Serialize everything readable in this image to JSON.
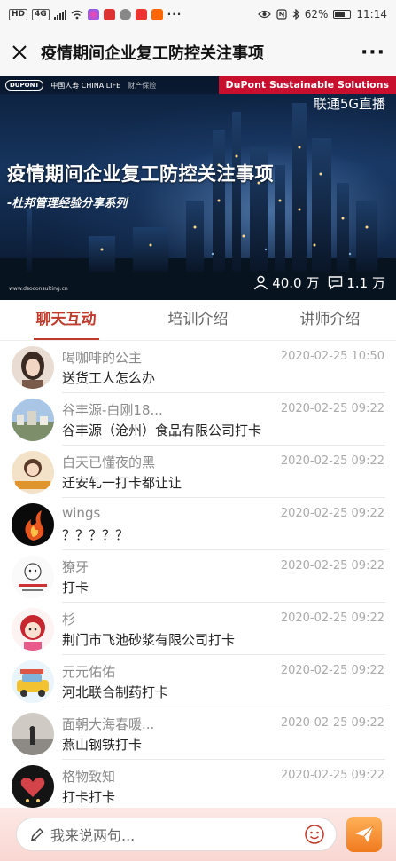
{
  "status_bar": {
    "left_tags": [
      "HD",
      "4G"
    ],
    "battery": "62%",
    "time": "11:14",
    "more_dots": "···"
  },
  "title_bar": {
    "title": "疫情期间企业复工防控关注事项",
    "more": "···"
  },
  "banner": {
    "logo_left": "DUPONT",
    "logo_chinalife": "中国人寿 CHINA LIFE",
    "logo_chinalife_sub": "财产保险",
    "brand_tag": "DuPont Sustainable Solutions",
    "live_label": "联通5G直播",
    "heading": "疫情期间企业复工防控关注事项",
    "subheading": "-杜邦管理经验分享系列",
    "url": "www.dsoconsulting.cn",
    "viewers": "40.0 万",
    "comments": "1.1 万"
  },
  "tabs": [
    {
      "label": "聊天互动",
      "active": true
    },
    {
      "label": "培训介绍",
      "active": false
    },
    {
      "label": "讲师介绍",
      "active": false
    }
  ],
  "chat": [
    {
      "name": "喝咖啡的公主",
      "time": "2020-02-25 10:50",
      "message": "送货工人怎么办",
      "avatar": "portrait-woman"
    },
    {
      "name": "谷丰源-白刚18...",
      "time": "2020-02-25 09:22",
      "message": "谷丰源（沧州）食品有限公司打卡",
      "avatar": "landscape-city"
    },
    {
      "name": "白天已懂夜的黑",
      "time": "2020-02-25 09:22",
      "message": "迁安轧一打卡都让让",
      "avatar": "cartoon-girl"
    },
    {
      "name": "wings",
      "time": "2020-02-25 09:22",
      "message": "？？？？？",
      "avatar": "fire-dark"
    },
    {
      "name": "獠牙",
      "time": "2020-02-25 09:22",
      "message": "打卡",
      "avatar": "doodle-white"
    },
    {
      "name": "杉",
      "time": "2020-02-25 09:22",
      "message": "荆门市飞池砂浆有限公司打卡",
      "avatar": "cartoon-red"
    },
    {
      "name": "元元佑佑",
      "time": "2020-02-25 09:22",
      "message": "河北联合制药打卡",
      "avatar": "yellow-car"
    },
    {
      "name": "面朝大海春暖...",
      "time": "2020-02-25 09:22",
      "message": "燕山钢铁打卡",
      "avatar": "sea-figure"
    },
    {
      "name": "格物致知",
      "time": "2020-02-25 09:22",
      "message": "打卡打卡",
      "avatar": "dark-heart"
    }
  ],
  "input": {
    "placeholder": "我来说两句..."
  },
  "colors": {
    "accent": "#c0392b",
    "brand_red": "#c8102e",
    "send_orange": "#f07a1e"
  }
}
